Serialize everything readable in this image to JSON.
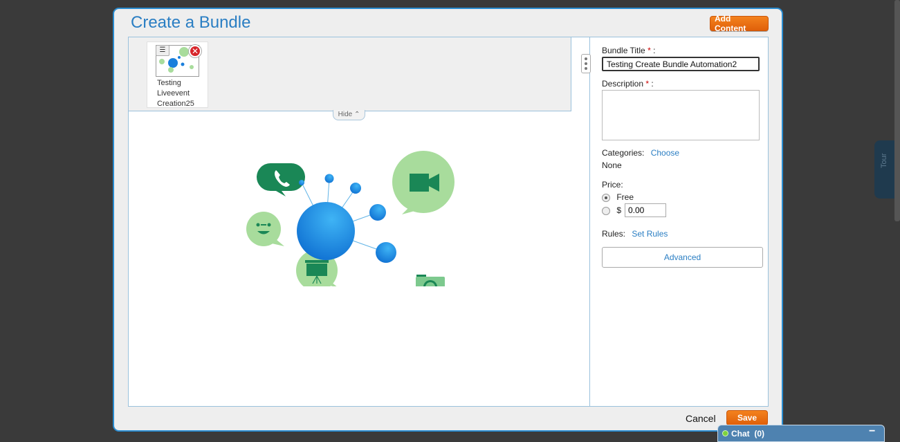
{
  "modal": {
    "title": "Create a Bundle",
    "add_content_label": "Add Content",
    "cancel_label": "Cancel",
    "save_label": "Save"
  },
  "tray": {
    "items": [
      {
        "title_lines": [
          "Testing",
          "Liveevent",
          "Creation25"
        ],
        "menu_glyph": "☰",
        "remove_glyph": "✕"
      }
    ],
    "hide_label": "Hide"
  },
  "form": {
    "bundle_title_label": "Bundle Title",
    "required_marker": "*",
    "label_suffix": ":",
    "bundle_title_value": "Testing Create Bundle Automation2",
    "description_label": "Description",
    "description_value": "",
    "categories_label": "Categories:",
    "categories_link": "Choose",
    "categories_value": "None",
    "price_label": "Price:",
    "price_options": [
      {
        "label": "Free",
        "selected": true
      },
      {
        "label": "$",
        "selected": false
      }
    ],
    "price_value": "0.00",
    "rules_label": "Rules:",
    "rules_link": "Set Rules",
    "advanced_label": "Advanced"
  },
  "side_tab": {
    "label": "Tour"
  },
  "chat": {
    "label": "Chat",
    "count": "(0)",
    "minimize_glyph": "−"
  },
  "icons": [
    "phone-icon",
    "video-camera-icon",
    "smiley-icon",
    "presentation-icon",
    "camera-icon",
    "network-hub-icon"
  ],
  "colors": {
    "accent": "#2a7ec3",
    "orange": "#f4821e",
    "green": "#a8dc9c",
    "dark_green": "#1a8756",
    "blue": "#1a7fdc"
  }
}
